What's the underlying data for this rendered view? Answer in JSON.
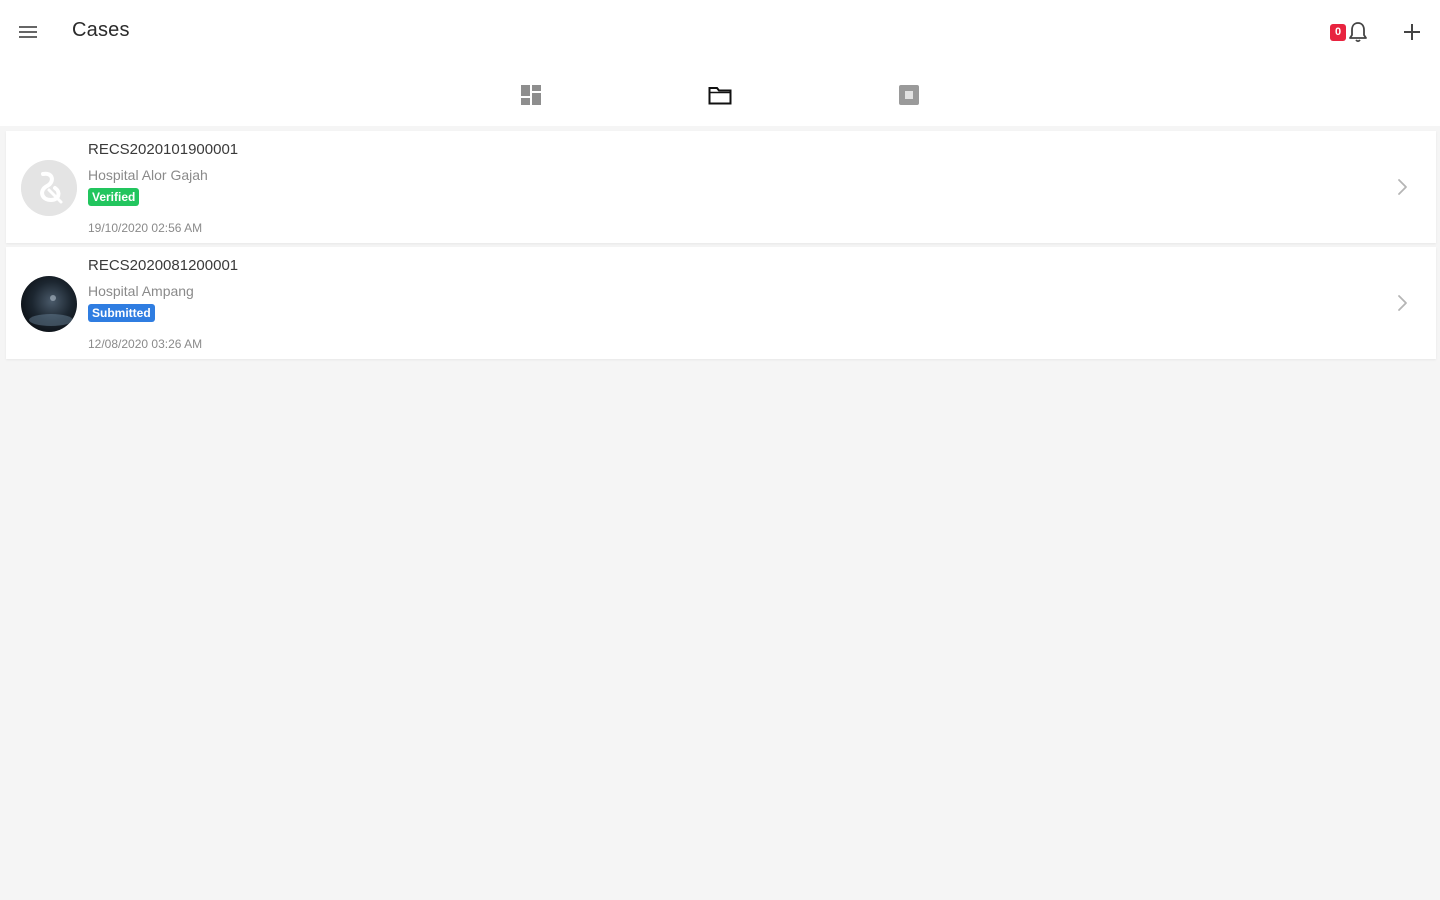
{
  "appbar": {
    "title": "Cases",
    "notification_count": "0"
  },
  "icons": {
    "menu": "menu-icon",
    "bell": "bell-icon",
    "add": "plus-icon",
    "tab_dashboard": "dashboard-icon",
    "tab_cases": "folder-icon",
    "tab_archive": "archive-box-icon",
    "chevron": "chevron-right-icon"
  },
  "colors": {
    "verified": "#22c55e",
    "submitted": "#2f7de1",
    "notification_badge": "#e8233f"
  },
  "cases": [
    {
      "id": "RECS2020101900001",
      "hospital": "Hospital Alor Gajah",
      "status": "Verified",
      "date": "19/10/2020 02:56 AM"
    },
    {
      "id": "RECS2020081200001",
      "hospital": "Hospital Ampang",
      "status": "Submitted",
      "date": "12/08/2020 03:26 AM"
    }
  ]
}
